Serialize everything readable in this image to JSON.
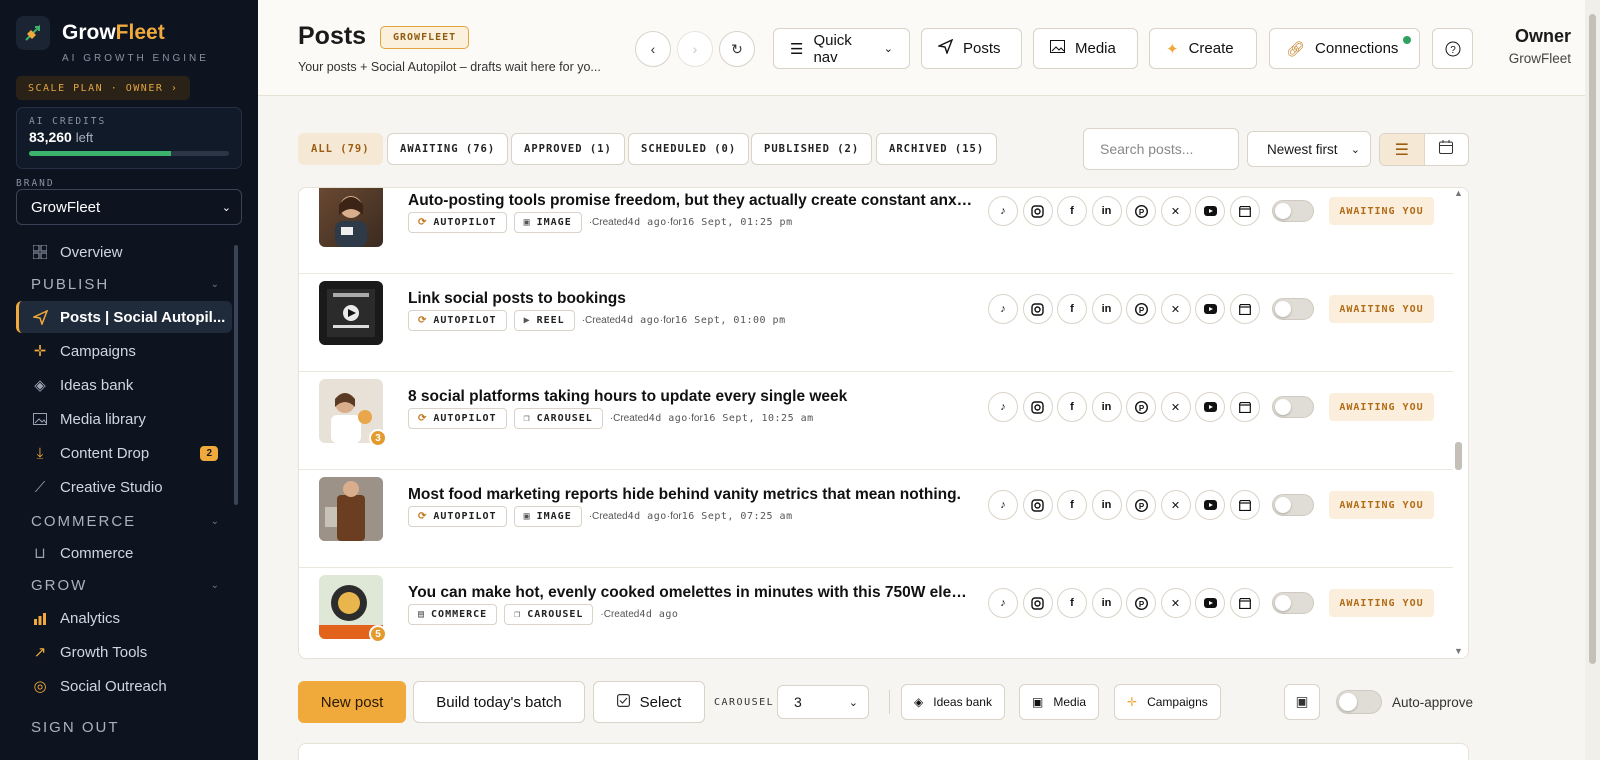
{
  "brand": {
    "name_main": "Grow",
    "name_accent": "Fleet",
    "tagline": "AI GROWTH ENGINE",
    "plan": "SCALE PLAN · OWNER ›",
    "accent_color": "#f0a93b"
  },
  "credits": {
    "label": "AI CREDITS",
    "value": "83,260",
    "suffix": "left",
    "fraction": 0.71
  },
  "brand_select": {
    "label": "BRAND",
    "value": "GrowFleet"
  },
  "nav": {
    "overview": "Overview",
    "publish_header": "PUBLISH",
    "posts": "Posts | Social Autopil...",
    "campaigns": "Campaigns",
    "ideas_bank": "Ideas bank",
    "media_library": "Media library",
    "content_drop": "Content Drop",
    "content_drop_badge": "2",
    "creative_studio": "Creative Studio",
    "commerce_header": "COMMERCE",
    "commerce": "Commerce",
    "grow_header": "GROW",
    "analytics": "Analytics",
    "growth_tools": "Growth Tools",
    "social_outreach": "Social Outreach",
    "sign_out": "SIGN OUT"
  },
  "header": {
    "title": "Posts",
    "badge": "GROWFLEET",
    "subtitle": "Your posts + Social Autopilot – drafts wait here for yo...",
    "quick_nav": "Quick nav",
    "posts_btn": "Posts",
    "media_btn": "Media",
    "create_btn": "Create",
    "connections_btn": "Connections",
    "owner_role": "Owner",
    "owner_org": "GrowFleet"
  },
  "filters": {
    "all": "ALL (79)",
    "awaiting": "AWAITING (76)",
    "approved": "APPROVED (1)",
    "scheduled": "SCHEDULED (0)",
    "published": "PUBLISHED (2)",
    "archived": "ARCHIVED (15)",
    "search_placeholder": "Search posts...",
    "sort": "Newest first"
  },
  "posts": [
    {
      "title": "Auto-posting tools promise freedom, but they actually create constant anxiety a...",
      "source": "AUTOPILOT",
      "format": "IMAGE",
      "created": "4d ago",
      "for": "16 Sept, 01:25 pm",
      "status": "AWAITING YOU"
    },
    {
      "title": "Link social posts to bookings",
      "source": "AUTOPILOT",
      "format": "REEL",
      "created": "4d ago",
      "for": "16 Sept, 01:00 pm",
      "status": "AWAITING YOU"
    },
    {
      "title": "8 social platforms taking hours to update every single week",
      "source": "AUTOPILOT",
      "format": "CAROUSEL",
      "created": "4d ago",
      "for": "16 Sept, 10:25 am",
      "status": "AWAITING YOU",
      "count": "3"
    },
    {
      "title": "Most food marketing reports hide behind vanity metrics that mean nothing.",
      "source": "AUTOPILOT",
      "format": "IMAGE",
      "created": "4d ago",
      "for": "16 Sept, 07:25 am",
      "status": "AWAITING YOU"
    },
    {
      "title": "You can make hot, evenly cooked omelettes in minutes with this 750W electric ...",
      "source": "COMMERCE",
      "format": "CAROUSEL",
      "created": "4d ago",
      "status": "AWAITING YOU",
      "count": "5"
    }
  ],
  "meta_labels": {
    "created": "·Created",
    "for": "·for"
  },
  "bottom": {
    "new_post": "New post",
    "build_batch": "Build today's batch",
    "select": "Select",
    "carousel_label": "CAROUSEL",
    "carousel_value": "3",
    "ideas_bank": "Ideas bank",
    "media": "Media",
    "campaigns": "Campaigns",
    "auto_approve": "Auto-approve"
  }
}
